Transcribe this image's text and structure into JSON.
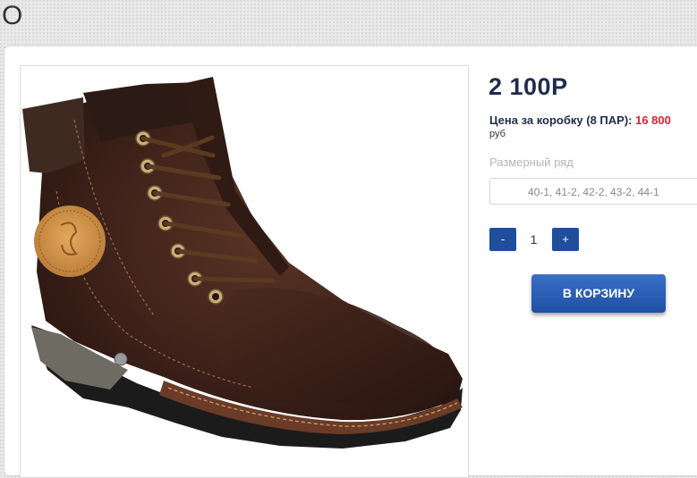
{
  "header": {
    "letter": "О"
  },
  "product": {
    "price": "2 100Р",
    "box_price_label": "Цена за коробку (8 ПАР):",
    "box_price_value": "16 800",
    "currency": "руб",
    "size_label": "Размерный ряд",
    "size_range": "40-1, 41-2, 42-2, 43-2, 44-1",
    "quantity": {
      "minus_label": "-",
      "value": "1",
      "plus_label": "+"
    },
    "cart_button_label": "В КОРЗИНУ",
    "image_icon": "brown-leather-boot-image"
  },
  "colors": {
    "accent_blue": "#1f4e9d",
    "price_navy": "#1e2d4c",
    "price_red": "#e2202f"
  }
}
